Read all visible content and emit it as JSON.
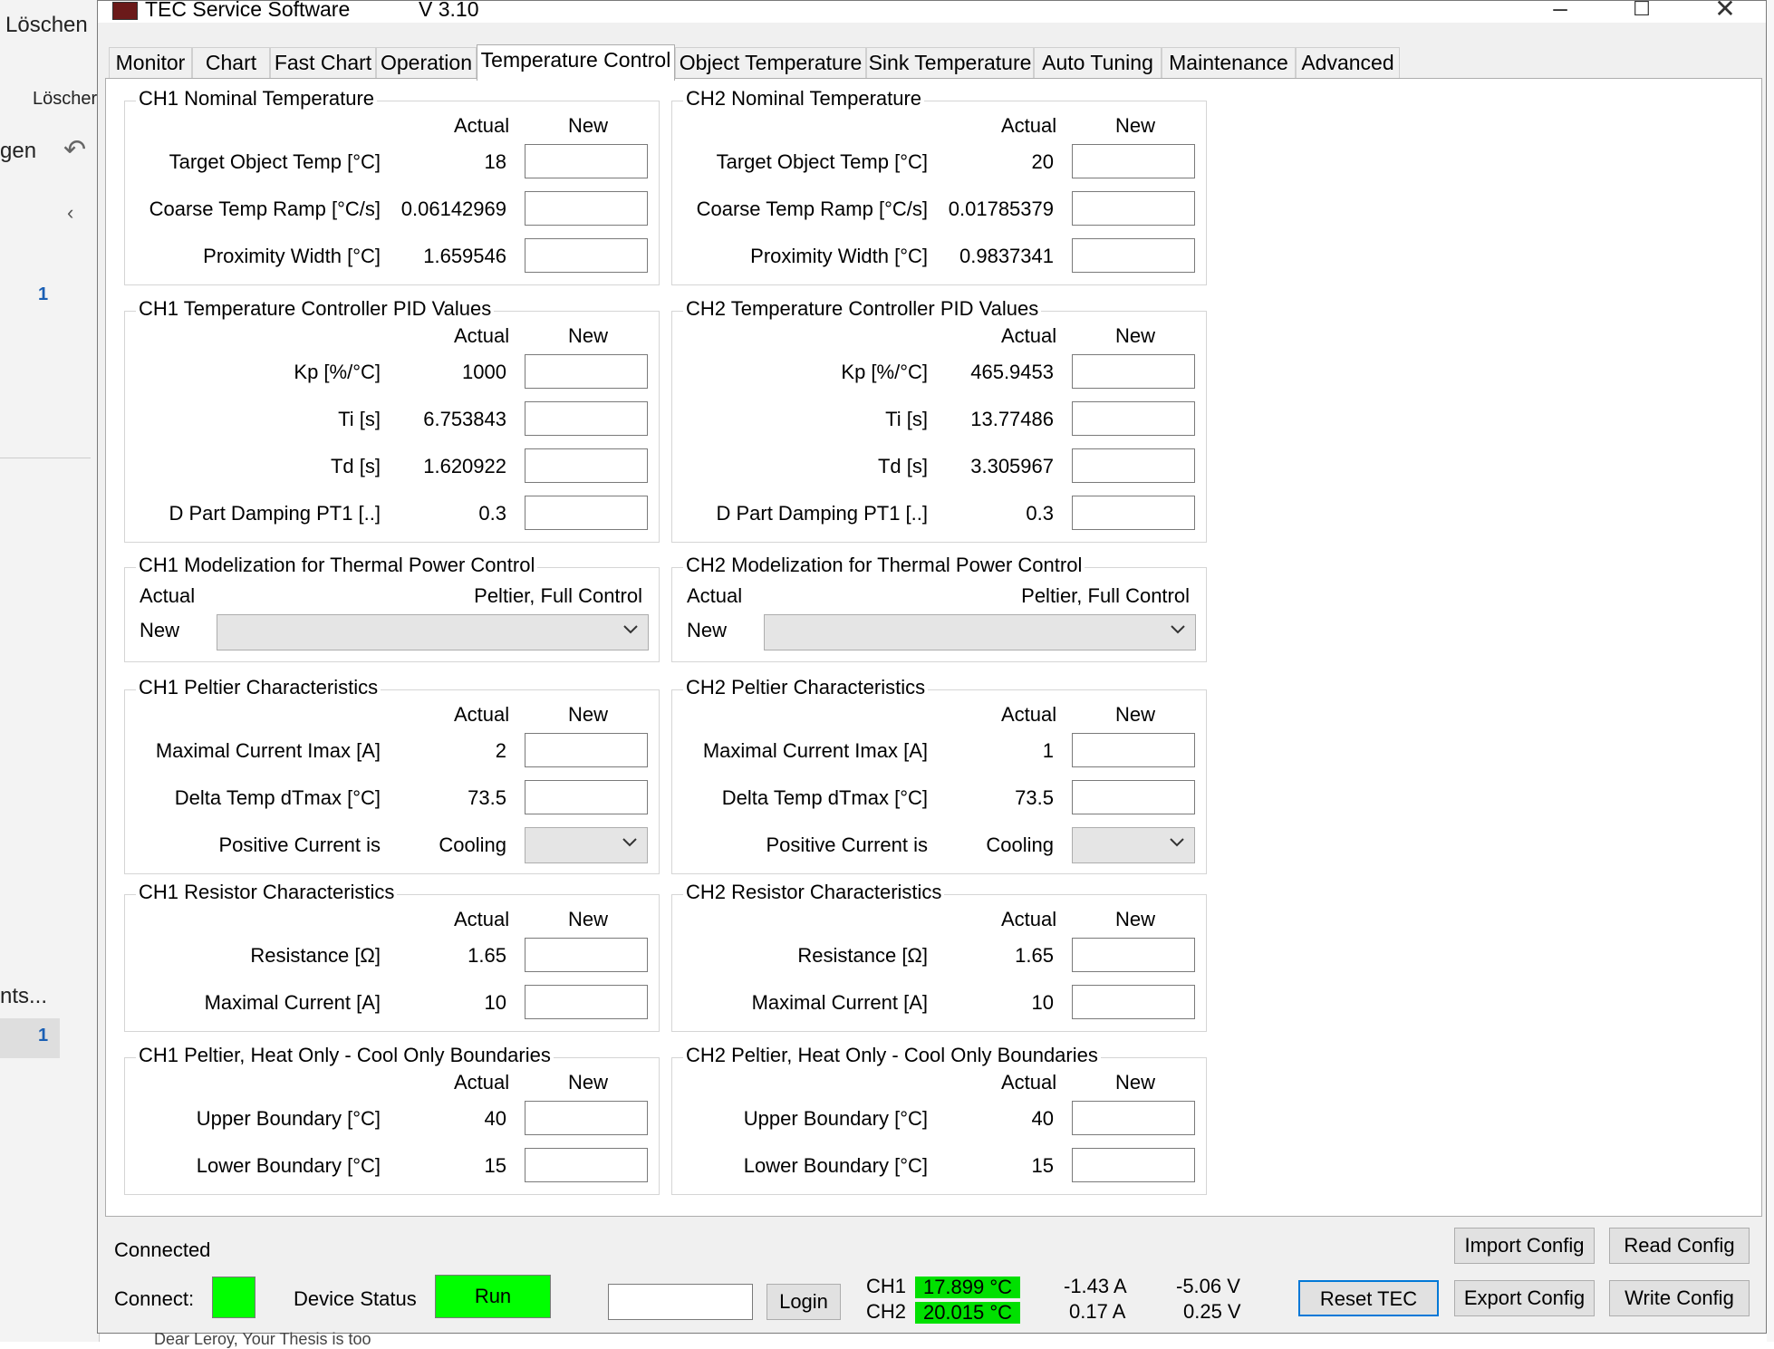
{
  "background": {
    "delete_label": "Löschen",
    "delete_sub_label": "Löscher",
    "partial_label": "gen",
    "count_1": "1",
    "partial_label_2": "nts...",
    "count_2": "1",
    "email_preview": "Dear Leroy, Your Thesis is too"
  },
  "window": {
    "title": "TEC Service Software",
    "version": "V 3.10"
  },
  "tabs": [
    "Monitor",
    "Chart",
    "Fast Chart",
    "Operation",
    "Temperature Control",
    "Object Temperature",
    "Sink Temperature",
    "Auto Tuning",
    "Maintenance",
    "Advanced"
  ],
  "headers": {
    "actual": "Actual",
    "new": "New"
  },
  "ch1": {
    "nominal": {
      "title": "CH1 Nominal Temperature",
      "rows": [
        {
          "label": "Target Object Temp [°C]",
          "value": "18"
        },
        {
          "label": "Coarse Temp Ramp [°C/s]",
          "value": "0.06142969"
        },
        {
          "label": "Proximity Width [°C]",
          "value": "1.659546"
        }
      ]
    },
    "pid": {
      "title": "CH1 Temperature Controller PID Values",
      "rows": [
        {
          "label": "Kp [%/°C]",
          "value": "1000"
        },
        {
          "label": "Ti [s]",
          "value": "6.753843"
        },
        {
          "label": "Td [s]",
          "value": "1.620922"
        },
        {
          "label": "D Part Damping PT1 [..]",
          "value": "0.3"
        }
      ]
    },
    "model": {
      "title": "CH1 Modelization for Thermal Power Control",
      "actual_label": "Actual",
      "actual_value": "Peltier, Full Control",
      "new_label": "New"
    },
    "peltier": {
      "title": "CH1 Peltier Characteristics",
      "rows": [
        {
          "label": "Maximal Current Imax [A]",
          "value": "2"
        },
        {
          "label": "Delta Temp dTmax [°C]",
          "value": "73.5"
        },
        {
          "label": "Positive Current is",
          "value": "Cooling"
        }
      ]
    },
    "resistor": {
      "title": "CH1 Resistor Characteristics",
      "rows": [
        {
          "label": "Resistance [Ω]",
          "value": "1.65"
        },
        {
          "label": "Maximal Current [A]",
          "value": "10"
        }
      ]
    },
    "boundaries": {
      "title": "CH1 Peltier, Heat Only - Cool Only Boundaries",
      "rows": [
        {
          "label": "Upper Boundary [°C]",
          "value": "40"
        },
        {
          "label": "Lower Boundary [°C]",
          "value": "15"
        }
      ]
    }
  },
  "ch2": {
    "nominal": {
      "title": "CH2 Nominal Temperature",
      "rows": [
        {
          "label": "Target Object Temp [°C]",
          "value": "20"
        },
        {
          "label": "Coarse Temp Ramp [°C/s]",
          "value": "0.01785379"
        },
        {
          "label": "Proximity Width [°C]",
          "value": "0.9837341"
        }
      ]
    },
    "pid": {
      "title": "CH2 Temperature Controller PID Values",
      "rows": [
        {
          "label": "Kp [%/°C]",
          "value": "465.9453"
        },
        {
          "label": "Ti [s]",
          "value": "13.77486"
        },
        {
          "label": "Td [s]",
          "value": "3.305967"
        },
        {
          "label": "D Part Damping PT1 [..]",
          "value": "0.3"
        }
      ]
    },
    "model": {
      "title": "CH2 Modelization for Thermal Power Control",
      "actual_label": "Actual",
      "actual_value": "Peltier, Full Control",
      "new_label": "New"
    },
    "peltier": {
      "title": "CH2 Peltier Characteristics",
      "rows": [
        {
          "label": "Maximal Current Imax [A]",
          "value": "1"
        },
        {
          "label": "Delta Temp dTmax [°C]",
          "value": "73.5"
        },
        {
          "label": "Positive Current is",
          "value": "Cooling"
        }
      ]
    },
    "resistor": {
      "title": "CH2 Resistor Characteristics",
      "rows": [
        {
          "label": "Resistance [Ω]",
          "value": "1.65"
        },
        {
          "label": "Maximal Current [A]",
          "value": "10"
        }
      ]
    },
    "boundaries": {
      "title": "CH2 Peltier, Heat Only - Cool Only Boundaries",
      "rows": [
        {
          "label": "Upper Boundary [°C]",
          "value": "40"
        },
        {
          "label": "Lower Boundary [°C]",
          "value": "15"
        }
      ]
    }
  },
  "status": {
    "connected": "Connected",
    "connect_label": "Connect:",
    "device_status_label": "Device Status",
    "device_status_value": "Run",
    "login_label": "Login",
    "ch1_label": "CH1",
    "ch1_temp": "17.899 °C",
    "ch1_current": "-1.43 A",
    "ch1_voltage": "-5.06 V",
    "ch2_label": "CH2",
    "ch2_temp": "20.015 °C",
    "ch2_current": "0.17 A",
    "ch2_voltage": "0.25 V",
    "reset": "Reset TEC",
    "import": "Import Config",
    "export": "Export Config",
    "read": "Read Config",
    "write": "Write Config"
  },
  "colors": {
    "status_green": "#00ff00",
    "temp_green": "#00e000",
    "active_tab": "#ffffff"
  }
}
